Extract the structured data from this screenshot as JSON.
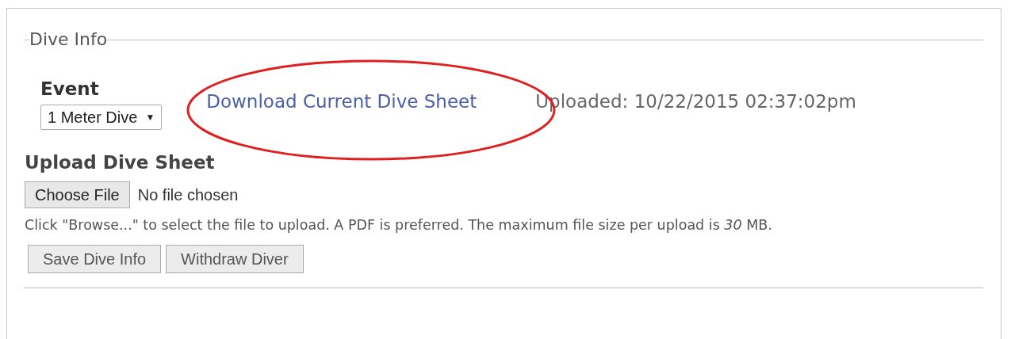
{
  "section": {
    "legend": "Dive Info"
  },
  "event": {
    "label": "Event",
    "value": "1 Meter Dive",
    "arrow": "▼"
  },
  "download_link": "Download Current Dive Sheet",
  "uploaded": "Uploaded: 10/22/2015 02:37:02pm",
  "upload": {
    "label": "Upload Dive Sheet",
    "button": "Choose File",
    "status": "No file chosen",
    "help": "Click \"Browse...\" to select the file to upload. A PDF is preferred. The maximum file size per upload is *30* MB."
  },
  "buttons": [
    "Save Dive Info",
    "Withdraw Diver"
  ]
}
